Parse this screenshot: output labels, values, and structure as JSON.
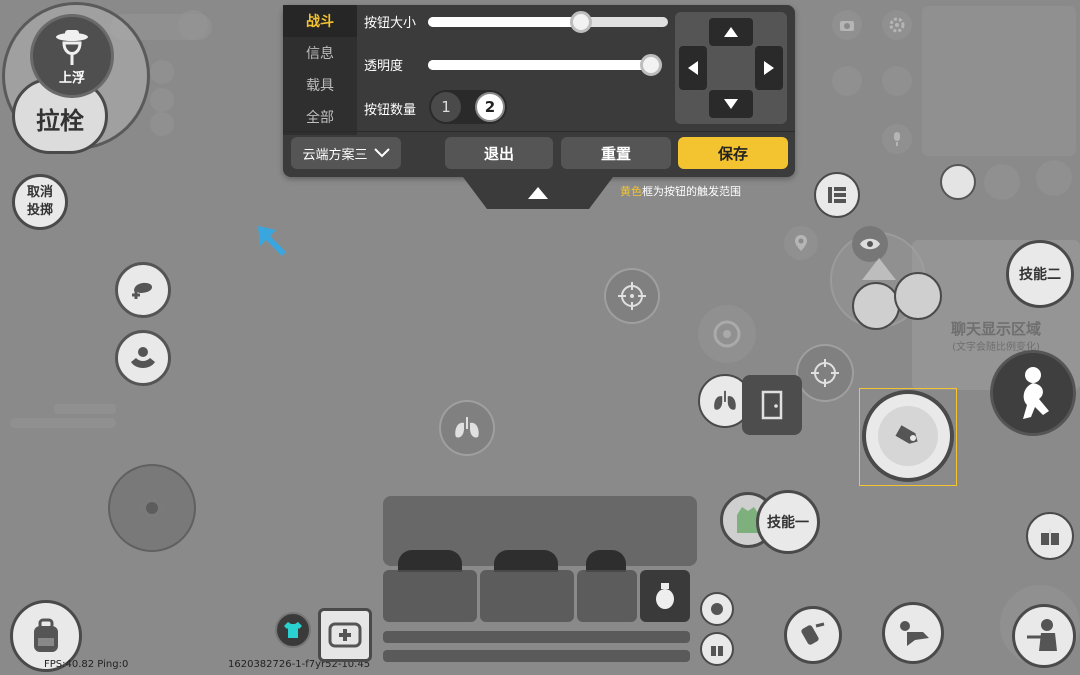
{
  "panel": {
    "tabs": [
      {
        "label": "战斗",
        "active": true
      },
      {
        "label": "信息",
        "active": false
      },
      {
        "label": "载具",
        "active": false
      },
      {
        "label": "全部",
        "active": false
      }
    ],
    "button_size_label": "按钮大小",
    "button_size_value": 0.65,
    "opacity_label": "透明度",
    "opacity_value": 1.0,
    "button_count_label": "按钮数量",
    "count_options": [
      "1",
      "2"
    ],
    "count_selected": "2",
    "scheme_select": "云端方案三",
    "exit_label": "退出",
    "reset_label": "重置",
    "save_label": "保存",
    "hint_highlight": "黄色",
    "hint_text": "框为按钮的触发范围"
  },
  "hud": {
    "float_label": "上浮",
    "bolt_label": "拉栓",
    "cancel_throw_label": "取消\n投掷",
    "skill_two_label": "技能二",
    "skill_one_label": "技能一",
    "chat_title": "聊天显示区域",
    "chat_sub": "(文字会随比例变化)",
    "fps_text": "FPS:40.82 Ping:0",
    "build_text": "1620382726-1-f7yr52-10.45"
  },
  "colors": {
    "accent_yellow": "#f4c430",
    "arrow_blue": "#3aa6e0",
    "panel_bg": "#3b3b3b",
    "background": "#8a8a8a"
  },
  "icons": [
    "ghost-float-icon",
    "bolt-icon",
    "drone-icon",
    "lungs-icon",
    "crosshair-icon",
    "eye-icon",
    "map-pin-icon",
    "steering-icon",
    "door-icon",
    "bullet-icon",
    "shirt-icon",
    "medkit-icon",
    "grenade-icon",
    "backpack-icon",
    "jump-icon",
    "camera-icon",
    "gear-icon",
    "mic-icon",
    "speaker-icon",
    "chat-icon"
  ]
}
